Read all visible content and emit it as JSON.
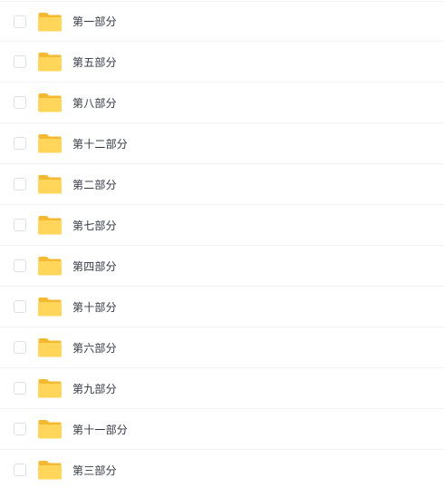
{
  "colors": {
    "folder_back": "#F5B930",
    "folder_front": "#FFD659",
    "text": "#333A45",
    "checkbox_border": "#DCDFE6",
    "divider": "#F2F3F5"
  },
  "files": [
    {
      "name": "第一部分",
      "icon": "folder-icon"
    },
    {
      "name": "第五部分",
      "icon": "folder-icon"
    },
    {
      "name": "第八部分",
      "icon": "folder-icon"
    },
    {
      "name": "第十二部分",
      "icon": "folder-icon"
    },
    {
      "name": "第二部分",
      "icon": "folder-icon"
    },
    {
      "name": "第七部分",
      "icon": "folder-icon"
    },
    {
      "name": "第四部分",
      "icon": "folder-icon"
    },
    {
      "name": "第十部分",
      "icon": "folder-icon"
    },
    {
      "name": "第六部分",
      "icon": "folder-icon"
    },
    {
      "name": "第九部分",
      "icon": "folder-icon"
    },
    {
      "name": "第十一部分",
      "icon": "folder-icon"
    },
    {
      "name": "第三部分",
      "icon": "folder-icon"
    }
  ]
}
